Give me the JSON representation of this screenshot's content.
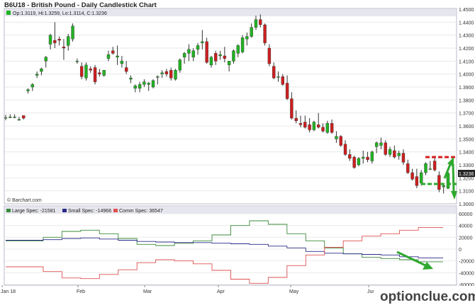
{
  "title": "B6U18 - British Pound - Daily Candlestick Chart",
  "ohlc_label": "Op:1.3119, Hi:1.3259, Lo:1.3114, C:1.3236",
  "last_price": "1.3236",
  "source": "© Barchart.com",
  "watermark": "optionclue.com",
  "colors": {
    "up": "#22b322",
    "down": "#cc1f1f",
    "large_spec": "#3a8a3a",
    "small_spec": "#2a2a8a",
    "comm_spec": "#e05050",
    "annotation_green": "#2fa82f",
    "annotation_red": "#d42020",
    "panel_header": "#e6e6ee"
  },
  "chart_data": [
    {
      "type": "candlestick",
      "title": "B6U18 - British Pound - Daily Candlestick Chart",
      "ylim": [
        1.3,
        1.45
      ],
      "y_ticks": [
        "1.4500",
        "1.4400",
        "1.4300",
        "1.4200",
        "1.4100",
        "1.4000",
        "1.3900",
        "1.3800",
        "1.3700",
        "1.3600",
        "1.3500",
        "1.3400",
        "1.3300",
        "1.3200",
        "1.3100",
        "1.3000"
      ],
      "x_ticks": [
        "Jan 18",
        "Feb",
        "Mar",
        "Apr",
        "May",
        "Jun"
      ],
      "candles": [
        {
          "o": 1.3665,
          "h": 1.3685,
          "l": 1.3645,
          "c": 1.3665
        },
        {
          "o": 1.367,
          "h": 1.369,
          "l": 1.366,
          "c": 1.367
        },
        {
          "o": 1.367,
          "h": 1.369,
          "l": 1.366,
          "c": 1.367
        },
        {
          "o": 1.365,
          "h": 1.367,
          "l": 1.364,
          "c": 1.365
        },
        {
          "o": 1.368,
          "h": 1.368,
          "l": 1.365,
          "c": 1.366
        },
        {
          "o": 1.387,
          "h": 1.389,
          "l": 1.385,
          "c": 1.388
        },
        {
          "o": 1.39,
          "h": 1.393,
          "l": 1.387,
          "c": 1.392
        },
        {
          "o": 1.399,
          "h": 1.402,
          "l": 1.397,
          "c": 1.4
        },
        {
          "o": 1.402,
          "h": 1.405,
          "l": 1.399,
          "c": 1.404
        },
        {
          "o": 1.41,
          "h": 1.414,
          "l": 1.405,
          "c": 1.413
        },
        {
          "o": 1.423,
          "h": 1.431,
          "l": 1.419,
          "c": 1.43
        },
        {
          "o": 1.426,
          "h": 1.44,
          "l": 1.42,
          "c": 1.424
        },
        {
          "o": 1.427,
          "h": 1.429,
          "l": 1.422,
          "c": 1.426
        },
        {
          "o": 1.421,
          "h": 1.427,
          "l": 1.411,
          "c": 1.42
        },
        {
          "o": 1.422,
          "h": 1.431,
          "l": 1.418,
          "c": 1.429
        },
        {
          "o": 1.427,
          "h": 1.439,
          "l": 1.425,
          "c": 1.437
        },
        {
          "o": 1.41,
          "h": 1.412,
          "l": 1.408,
          "c": 1.41
        },
        {
          "o": 1.406,
          "h": 1.409,
          "l": 1.396,
          "c": 1.398
        },
        {
          "o": 1.397,
          "h": 1.409,
          "l": 1.395,
          "c": 1.407
        },
        {
          "o": 1.404,
          "h": 1.406,
          "l": 1.401,
          "c": 1.403
        },
        {
          "o": 1.405,
          "h": 1.407,
          "l": 1.392,
          "c": 1.394
        },
        {
          "o": 1.401,
          "h": 1.404,
          "l": 1.398,
          "c": 1.4
        },
        {
          "o": 1.399,
          "h": 1.403,
          "l": 1.398,
          "c": 1.403
        },
        {
          "o": 1.412,
          "h": 1.418,
          "l": 1.41,
          "c": 1.415
        },
        {
          "o": 1.418,
          "h": 1.421,
          "l": 1.415,
          "c": 1.416
        },
        {
          "o": 1.413,
          "h": 1.422,
          "l": 1.407,
          "c": 1.414
        },
        {
          "o": 1.408,
          "h": 1.414,
          "l": 1.405,
          "c": 1.41
        },
        {
          "o": 1.405,
          "h": 1.41,
          "l": 1.4,
          "c": 1.402
        },
        {
          "o": 1.396,
          "h": 1.399,
          "l": 1.393,
          "c": 1.397
        },
        {
          "o": 1.389,
          "h": 1.392,
          "l": 1.386,
          "c": 1.391
        },
        {
          "o": 1.389,
          "h": 1.394,
          "l": 1.386,
          "c": 1.392
        },
        {
          "o": 1.392,
          "h": 1.396,
          "l": 1.39,
          "c": 1.394
        },
        {
          "o": 1.392,
          "h": 1.394,
          "l": 1.387,
          "c": 1.393
        },
        {
          "o": 1.39,
          "h": 1.396,
          "l": 1.389,
          "c": 1.395
        },
        {
          "o": 1.398,
          "h": 1.399,
          "l": 1.392,
          "c": 1.398
        },
        {
          "o": 1.4,
          "h": 1.403,
          "l": 1.397,
          "c": 1.401
        },
        {
          "o": 1.402,
          "h": 1.404,
          "l": 1.398,
          "c": 1.4
        },
        {
          "o": 1.403,
          "h": 1.405,
          "l": 1.395,
          "c": 1.397
        },
        {
          "o": 1.396,
          "h": 1.404,
          "l": 1.395,
          "c": 1.403
        },
        {
          "o": 1.403,
          "h": 1.412,
          "l": 1.401,
          "c": 1.411
        },
        {
          "o": 1.413,
          "h": 1.417,
          "l": 1.408,
          "c": 1.416
        },
        {
          "o": 1.416,
          "h": 1.423,
          "l": 1.41,
          "c": 1.419
        },
        {
          "o": 1.413,
          "h": 1.42,
          "l": 1.41,
          "c": 1.418
        },
        {
          "o": 1.419,
          "h": 1.424,
          "l": 1.415,
          "c": 1.422
        },
        {
          "o": 1.424,
          "h": 1.434,
          "l": 1.419,
          "c": 1.425
        },
        {
          "o": 1.425,
          "h": 1.428,
          "l": 1.408,
          "c": 1.409
        },
        {
          "o": 1.407,
          "h": 1.414,
          "l": 1.405,
          "c": 1.413
        },
        {
          "o": 1.416,
          "h": 1.418,
          "l": 1.407,
          "c": 1.41
        },
        {
          "o": 1.414,
          "h": 1.418,
          "l": 1.411,
          "c": 1.415
        },
        {
          "o": 1.414,
          "h": 1.421,
          "l": 1.409,
          "c": 1.412
        },
        {
          "o": 1.407,
          "h": 1.41,
          "l": 1.402,
          "c": 1.41
        },
        {
          "o": 1.41,
          "h": 1.419,
          "l": 1.408,
          "c": 1.418
        },
        {
          "o": 1.416,
          "h": 1.423,
          "l": 1.413,
          "c": 1.422
        },
        {
          "o": 1.417,
          "h": 1.43,
          "l": 1.416,
          "c": 1.428
        },
        {
          "o": 1.427,
          "h": 1.432,
          "l": 1.422,
          "c": 1.429
        },
        {
          "o": 1.429,
          "h": 1.439,
          "l": 1.428,
          "c": 1.436
        },
        {
          "o": 1.436,
          "h": 1.445,
          "l": 1.434,
          "c": 1.442
        },
        {
          "o": 1.442,
          "h": 1.446,
          "l": 1.436,
          "c": 1.438
        },
        {
          "o": 1.438,
          "h": 1.439,
          "l": 1.422,
          "c": 1.424
        },
        {
          "o": 1.42,
          "h": 1.423,
          "l": 1.406,
          "c": 1.408
        },
        {
          "o": 1.406,
          "h": 1.409,
          "l": 1.396,
          "c": 1.397
        },
        {
          "o": 1.398,
          "h": 1.402,
          "l": 1.394,
          "c": 1.398
        },
        {
          "o": 1.398,
          "h": 1.4,
          "l": 1.391,
          "c": 1.392
        },
        {
          "o": 1.393,
          "h": 1.399,
          "l": 1.38,
          "c": 1.381
        },
        {
          "o": 1.381,
          "h": 1.386,
          "l": 1.365,
          "c": 1.366
        },
        {
          "o": 1.366,
          "h": 1.372,
          "l": 1.362,
          "c": 1.364
        },
        {
          "o": 1.362,
          "h": 1.368,
          "l": 1.359,
          "c": 1.361
        },
        {
          "o": 1.363,
          "h": 1.368,
          "l": 1.358,
          "c": 1.359
        },
        {
          "o": 1.361,
          "h": 1.366,
          "l": 1.355,
          "c": 1.357
        },
        {
          "o": 1.357,
          "h": 1.364,
          "l": 1.356,
          "c": 1.363
        },
        {
          "o": 1.361,
          "h": 1.37,
          "l": 1.358,
          "c": 1.359
        },
        {
          "o": 1.359,
          "h": 1.362,
          "l": 1.355,
          "c": 1.356
        },
        {
          "o": 1.355,
          "h": 1.364,
          "l": 1.354,
          "c": 1.362
        },
        {
          "o": 1.362,
          "h": 1.365,
          "l": 1.354,
          "c": 1.355
        },
        {
          "o": 1.35,
          "h": 1.356,
          "l": 1.347,
          "c": 1.352
        },
        {
          "o": 1.352,
          "h": 1.353,
          "l": 1.344,
          "c": 1.345
        },
        {
          "o": 1.346,
          "h": 1.349,
          "l": 1.337,
          "c": 1.338
        },
        {
          "o": 1.338,
          "h": 1.342,
          "l": 1.333,
          "c": 1.335
        },
        {
          "o": 1.336,
          "h": 1.337,
          "l": 1.327,
          "c": 1.328
        },
        {
          "o": 1.33,
          "h": 1.336,
          "l": 1.329,
          "c": 1.335
        },
        {
          "o": 1.335,
          "h": 1.341,
          "l": 1.331,
          "c": 1.336
        },
        {
          "o": 1.336,
          "h": 1.34,
          "l": 1.332,
          "c": 1.334
        },
        {
          "o": 1.333,
          "h": 1.341,
          "l": 1.331,
          "c": 1.34
        },
        {
          "o": 1.344,
          "h": 1.348,
          "l": 1.339,
          "c": 1.347
        },
        {
          "o": 1.345,
          "h": 1.351,
          "l": 1.342,
          "c": 1.347
        },
        {
          "o": 1.347,
          "h": 1.349,
          "l": 1.337,
          "c": 1.338
        },
        {
          "o": 1.338,
          "h": 1.344,
          "l": 1.336,
          "c": 1.342
        },
        {
          "o": 1.341,
          "h": 1.345,
          "l": 1.335,
          "c": 1.336
        },
        {
          "o": 1.337,
          "h": 1.341,
          "l": 1.334,
          "c": 1.339
        },
        {
          "o": 1.339,
          "h": 1.342,
          "l": 1.33,
          "c": 1.332
        },
        {
          "o": 1.331,
          "h": 1.334,
          "l": 1.323,
          "c": 1.324
        },
        {
          "o": 1.324,
          "h": 1.327,
          "l": 1.318,
          "c": 1.319
        },
        {
          "o": 1.321,
          "h": 1.327,
          "l": 1.312,
          "c": 1.314
        },
        {
          "o": 1.316,
          "h": 1.326,
          "l": 1.314,
          "c": 1.324
        },
        {
          "o": 1.324,
          "h": 1.332,
          "l": 1.322,
          "c": 1.331
        },
        {
          "o": 1.327,
          "h": 1.333,
          "l": 1.326,
          "c": 1.327
        },
        {
          "o": 1.333,
          "h": 1.337,
          "l": 1.325,
          "c": 1.326
        },
        {
          "o": 1.322,
          "h": 1.325,
          "l": 1.309,
          "c": 1.311
        },
        {
          "o": 1.313,
          "h": 1.316,
          "l": 1.308,
          "c": 1.314
        },
        {
          "o": 1.3119,
          "h": 1.3259,
          "l": 1.3114,
          "c": 1.3236
        }
      ]
    },
    {
      "type": "line",
      "title": "COT positions",
      "ylim": [
        -60000,
        60000
      ],
      "y_ticks": [
        "60000",
        "40000",
        "20000",
        "0",
        "-20000",
        "-40000",
        "-60000"
      ],
      "series": [
        {
          "name": "Large Spec: -21581",
          "values": [
            14000,
            14000,
            20000,
            30000,
            32000,
            26000,
            18000,
            8000,
            6000,
            10000,
            14000,
            24000,
            40000,
            48000,
            42000,
            26000,
            14000,
            2000,
            -8000,
            -14000,
            -16000,
            -18000,
            -21581
          ]
        },
        {
          "name": "Small Spec: -14966",
          "values": [
            15000,
            15000,
            16000,
            18000,
            19000,
            17000,
            15000,
            13000,
            12000,
            11000,
            11000,
            10000,
            9000,
            8000,
            5000,
            2000,
            -4000,
            -7000,
            -8000,
            -9000,
            -10000,
            -13000,
            -14966
          ]
        },
        {
          "name": "Comm Spec: 36547",
          "values": [
            -30000,
            -30000,
            -38000,
            -49000,
            -50000,
            -43000,
            -35000,
            -23000,
            -18000,
            -20000,
            -25000,
            -36000,
            -51000,
            -58000,
            -48000,
            -28000,
            -10000,
            3000,
            14000,
            22000,
            26000,
            32000,
            36547
          ]
        }
      ]
    }
  ]
}
